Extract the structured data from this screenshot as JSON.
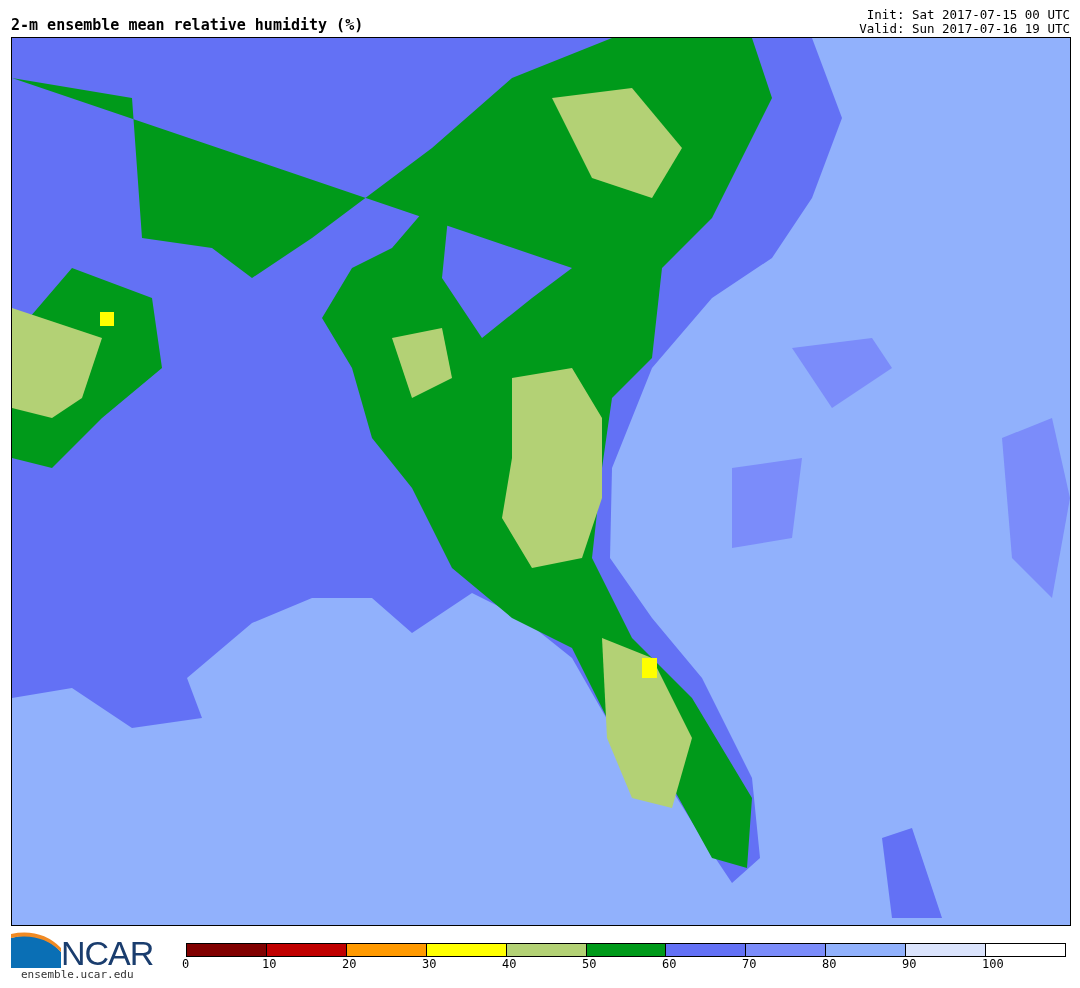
{
  "title": "2-m ensemble mean relative humidity (%)",
  "init": "Init: Sat 2017-07-15 00 UTC",
  "valid": "Valid: Sun 2017-07-16 19 UTC",
  "logo": {
    "name": "NCAR",
    "url": "ensemble.ucar.edu"
  },
  "colorbar": {
    "bins": [
      {
        "color": "#800000",
        "label": "0"
      },
      {
        "color": "#c00000",
        "label": "10"
      },
      {
        "color": "#ff9900",
        "label": "20"
      },
      {
        "color": "#ffff00",
        "label": "30"
      },
      {
        "color": "#b3d175",
        "label": "40"
      },
      {
        "color": "#009a1a",
        "label": "50"
      },
      {
        "color": "#6371f5",
        "label": "60"
      },
      {
        "color": "#7b8cfa",
        "label": "70"
      },
      {
        "color": "#91b1fc",
        "label": "80"
      },
      {
        "color": "#dbe4fd",
        "label": "90"
      },
      {
        "color": "#ffffff",
        "label": "100"
      }
    ]
  }
}
